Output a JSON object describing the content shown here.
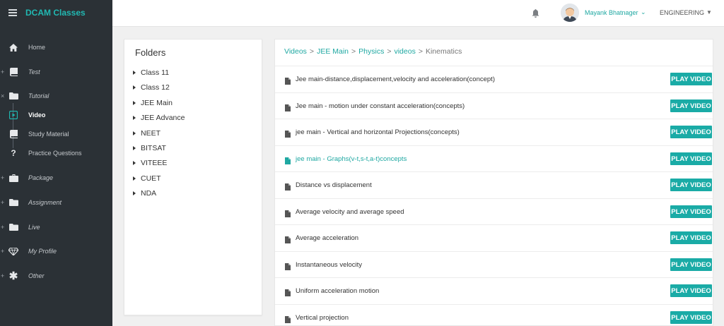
{
  "sidebar": {
    "brand": "DCAM Classes",
    "items": [
      {
        "label": "Home",
        "icon": "home-icon"
      },
      {
        "label": "Test",
        "icon": "book-icon"
      },
      {
        "label": "Tutorial",
        "icon": "folder-icon"
      },
      {
        "label": "Video",
        "icon": "video-icon"
      },
      {
        "label": "Study Material",
        "icon": "book-icon"
      },
      {
        "label": "Practice Questions",
        "icon": "question-icon"
      },
      {
        "label": "Package",
        "icon": "briefcase-icon"
      },
      {
        "label": "Assignment",
        "icon": "folder-icon"
      },
      {
        "label": "Live",
        "icon": "folder-icon"
      },
      {
        "label": "My Profile",
        "icon": "diamond-icon"
      },
      {
        "label": "Other",
        "icon": "asterisk-icon"
      }
    ]
  },
  "topbar": {
    "user_name": "Mayank Bhatnager",
    "user_caret": "⌄",
    "department": "ENGINEERING",
    "dept_caret": "▼"
  },
  "folders": {
    "title": "Folders",
    "items": [
      "Class 11",
      "Class 12",
      "JEE Main",
      "JEE Advance",
      "NEET",
      "BITSAT",
      "VITEEE",
      "CUET",
      "NDA"
    ]
  },
  "videos": {
    "breadcrumb": {
      "links": [
        "Videos",
        "JEE Main",
        "Physics",
        "videos"
      ],
      "separator": ">",
      "current": "Kinematics"
    },
    "button_label": "PLAY VIDEO",
    "rows": [
      "Jee main-distance,displacement,velocity and acceleration(concept)",
      "Jee main - motion under constant acceleration(concepts)",
      "jee main - Vertical and horizontal Projections(concepts)",
      "jee main - Graphs(v-t,s-t,a-t)concepts",
      "Distance vs displacement",
      "Average velocity and average speed",
      "Average acceleration",
      "Instantaneous velocity",
      "Uniform acceleration motion",
      "Vertical projection"
    ]
  },
  "colors": {
    "accent": "#1aaba6",
    "sidebar_bg": "#2b3136",
    "brand": "#21b8b2"
  }
}
